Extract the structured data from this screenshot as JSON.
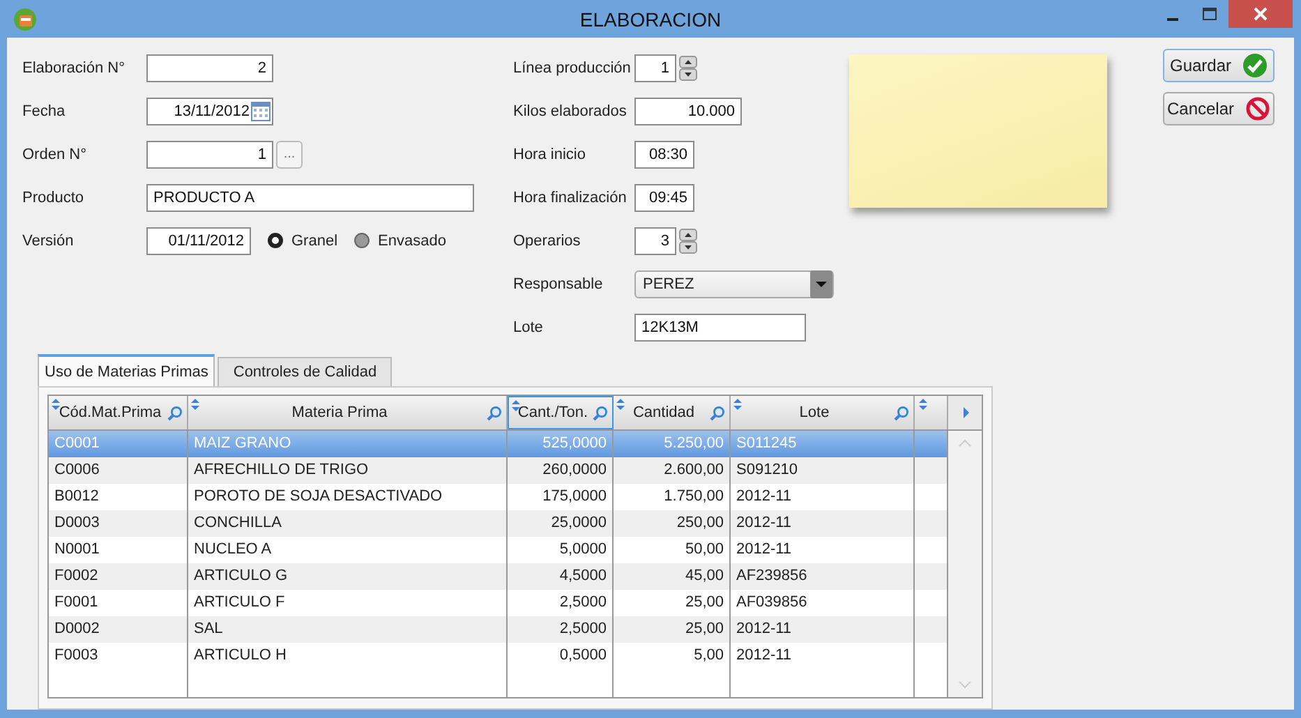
{
  "window": {
    "title": "ELABORACION"
  },
  "left_fields": [
    {
      "label": "Elaboración N°",
      "value": "2",
      "kind": "number"
    },
    {
      "label": "Fecha",
      "value": "13/11/2012",
      "kind": "date"
    },
    {
      "label": "Orden N°",
      "value": "1",
      "kind": "lookup",
      "button_text": "..."
    },
    {
      "label": "Producto",
      "value": "PRODUCTO A",
      "kind": "text"
    },
    {
      "label": "Versión",
      "value": "01/11/2012",
      "kind": "version",
      "options": [
        {
          "label": "Granel",
          "selected": true
        },
        {
          "label": "Envasado",
          "selected": false
        }
      ]
    }
  ],
  "right_fields": [
    {
      "label": "Línea producción",
      "value": "1",
      "kind": "spinner"
    },
    {
      "label": "Kilos elaborados",
      "value": "10.000",
      "kind": "number"
    },
    {
      "label": "Hora inicio",
      "value": "08:30",
      "kind": "time"
    },
    {
      "label": "Hora finalización",
      "value": "09:45",
      "kind": "time"
    },
    {
      "label": "Operarios",
      "value": "3",
      "kind": "spinner"
    },
    {
      "label": "Responsable",
      "value": "PEREZ",
      "kind": "dropdown"
    },
    {
      "label": "Lote",
      "value": "12K13M",
      "kind": "text"
    }
  ],
  "buttons": [
    {
      "label": "Guardar",
      "kind": "save"
    },
    {
      "label": "Cancelar",
      "kind": "cancel"
    }
  ],
  "tabs": [
    {
      "label": "Uso de Materias Primas",
      "selected": true
    },
    {
      "label": "Controles de Calidad",
      "selected": false
    }
  ],
  "table": {
    "columns": [
      {
        "label": "Cód.Mat.Prima",
        "kind": "text",
        "active": false
      },
      {
        "label": "Materia Prima",
        "kind": "text",
        "active": false
      },
      {
        "label": "Cant./Ton.",
        "kind": "number",
        "active": true
      },
      {
        "label": "Cantidad",
        "kind": "number",
        "active": false
      },
      {
        "label": "Lote",
        "kind": "text",
        "active": false
      }
    ],
    "rows": [
      {
        "cells": [
          "C0001",
          "MAIZ GRANO",
          "525,0000",
          "5.250,00",
          "S011245"
        ],
        "selected": true
      },
      {
        "cells": [
          "C0006",
          "AFRECHILLO DE TRIGO",
          "260,0000",
          "2.600,00",
          "S091210"
        ],
        "selected": false
      },
      {
        "cells": [
          "B0012",
          "POROTO DE SOJA DESACTIVADO",
          "175,0000",
          "1.750,00",
          "2012-11"
        ],
        "selected": false
      },
      {
        "cells": [
          "D0003",
          "CONCHILLA",
          "25,0000",
          "250,00",
          "2012-11"
        ],
        "selected": false
      },
      {
        "cells": [
          "N0001",
          "NUCLEO A",
          "5,0000",
          "50,00",
          "2012-11"
        ],
        "selected": false
      },
      {
        "cells": [
          "F0002",
          "ARTICULO G",
          "4,5000",
          "45,00",
          "AF239856"
        ],
        "selected": false
      },
      {
        "cells": [
          "F0001",
          "ARTICULO F",
          "2,5000",
          "25,00",
          "AF039856"
        ],
        "selected": false
      },
      {
        "cells": [
          "D0002",
          "SAL",
          "2,5000",
          "25,00",
          "2012-11"
        ],
        "selected": false
      },
      {
        "cells": [
          "F0003",
          "ARTICULO H",
          "0,5000",
          "5,00",
          "2012-11"
        ],
        "selected": false
      }
    ]
  }
}
